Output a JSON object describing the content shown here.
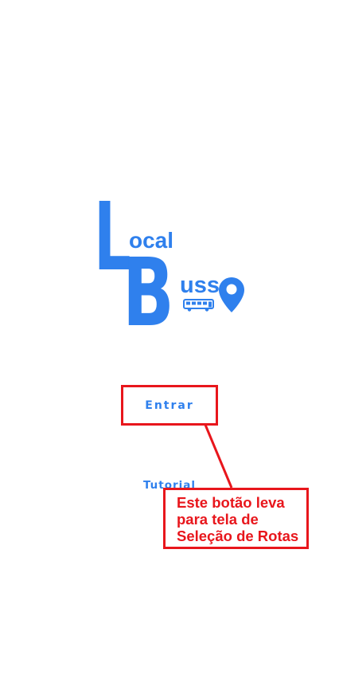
{
  "app": {
    "logo": {
      "letter_L": "L",
      "text_ocal": "ocal",
      "letter_B": "B",
      "text_uss": "uss",
      "bus_icon": "bus-icon",
      "pin_icon": "location-pin-icon",
      "color": "#2f80ed"
    },
    "buttons": {
      "entrar": "Entrar",
      "tutorial": "Tutorial"
    }
  },
  "annotation": {
    "color": "#e8161c",
    "callout_lines": [
      "Este botão leva",
      "para tela de",
      "Seleção de Rotas"
    ]
  }
}
